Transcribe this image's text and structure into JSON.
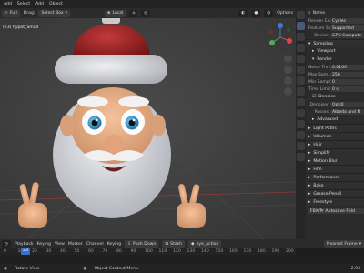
{
  "topbar": {
    "menus": [
      "Add",
      "Select",
      "Add",
      "Object"
    ]
  },
  "viewport_header": {
    "mode": "Full",
    "drag_label": "Drag:",
    "drag_value": "Select Box",
    "pivot": "Local",
    "options": "Options"
  },
  "viewport": {
    "object_name": "(23) hypot_Small"
  },
  "properties": {
    "header_label": "Name",
    "render_engine": {
      "label": "Render Engi",
      "value": "Cycles"
    },
    "feature_set": {
      "label": "Feature Set",
      "value": "Supported"
    },
    "device": {
      "label": "Device",
      "value": "GPU Compute"
    },
    "sampling": "Sampling",
    "viewport": "Viewport",
    "render": "Render",
    "noise_thresh": {
      "label": "Noise Thres",
      "value": "0.0100"
    },
    "max_samples": {
      "label": "Max Sam...",
      "value": "256"
    },
    "min_samples": {
      "label": "Min Sampl...",
      "value": "0"
    },
    "time_limit": {
      "label": "Time Limit",
      "value": "0 s"
    },
    "denoise": "Denoise",
    "denoise_values": [
      "Denoiser",
      "OptiX",
      "Passes",
      "Albedo and N"
    ],
    "advanced": "Advanced",
    "sections": [
      "Light Paths",
      "Volumes",
      "Hair",
      "Simplify",
      "Motion Blur",
      "Film",
      "Performance",
      "Bake",
      "Grease Pencil",
      "Freestyle"
    ],
    "footer": "FBX/Pr Autosave Fold"
  },
  "timeline": {
    "header": [
      "Playback",
      "Keying",
      "View",
      "Marker"
    ],
    "channel_label": "Channel",
    "keying_set": "Keying",
    "push_down": "Push Down",
    "stash": "Stash",
    "action_name": "eye_action",
    "auto_keying": "Nearest Frame",
    "ruler": [
      "0",
      "10",
      "20",
      "30",
      "40",
      "50",
      "60",
      "70",
      "80",
      "90",
      "100",
      "110",
      "120",
      "130",
      "140",
      "150",
      "160",
      "170",
      "180",
      "190",
      "200"
    ],
    "current_frame": "23"
  },
  "status": {
    "left": "Rotate View",
    "mid": "Object Context Menu",
    "right": "2.93"
  }
}
